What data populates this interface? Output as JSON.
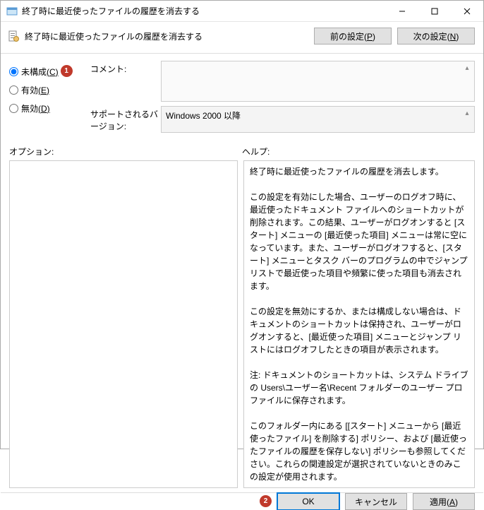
{
  "window": {
    "title": "終了時に最近使ったファイルの履歴を消去する"
  },
  "header": {
    "title": "終了時に最近使ったファイルの履歴を消去する",
    "prev_button": "前の設定(P)",
    "next_button": "次の設定(N)"
  },
  "radios": {
    "not_configured": "未構成",
    "not_configured_u": "(C)",
    "enabled": "有効",
    "enabled_u": "(E)",
    "disabled": "無効",
    "disabled_u": "(D)",
    "selected": "not_configured"
  },
  "markers": {
    "one": "1",
    "two": "2"
  },
  "fields": {
    "comment_label": "コメント:",
    "comment_value": "",
    "supported_label": "サポートされるバージョン:",
    "supported_value": "Windows 2000 以降"
  },
  "panes": {
    "options_label": "オプション:",
    "help_label": "ヘルプ:",
    "help_text": "終了時に最近使ったファイルの履歴を消去します。\n\nこの設定を有効にした場合、ユーザーのログオフ時に、最近使ったドキュメント ファイルへのショートカットが削除されます。この結果、ユーザーがログオンすると [スタート] メニューの [最近使った項目] メニューは常に空になっています。また、ユーザーがログオフすると、[スタート] メニューとタスク バーのプログラムの中でジャンプ リストで最近使った項目や頻繁に使った項目も消去されます。\n\nこの設定を無効にするか、または構成しない場合は、ドキュメントのショートカットは保持され、ユーザーがログオンすると、[最近使った項目] メニューとジャンプ リストにはログオフしたときの項目が表示されます。\n\n注: ドキュメントのショートカットは、システム ドライブの Users\\ユーザー名\\Recent フォルダーのユーザー プロファイルに保存されます。\n\nこのフォルダー内にある [[スタート] メニューから [最近使ったファイル] を削除する] ポリシー、および [最近使ったファイルの履歴を保存しない] ポリシーも参照してください。これらの関連設定が選択されていないときのみこの設定が使用されます。"
  },
  "footer": {
    "ok": "OK",
    "cancel": "キャンセル",
    "apply": "適用(A)"
  }
}
